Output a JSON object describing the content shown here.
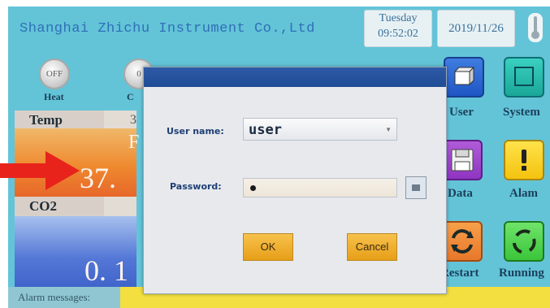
{
  "header": {
    "company": "Shanghai Zhichu Instrument Co.,Ltd",
    "weekday": "Tuesday",
    "time": "09:52:02",
    "date": "2019/11/26"
  },
  "toggles": [
    {
      "state": "OFF",
      "label": "Heat"
    },
    {
      "state": "0",
      "label": "C"
    }
  ],
  "panels": {
    "temp_label": "Temp",
    "temp_partial": "3",
    "temp_mode_partial": "F",
    "temp_value_partial": "37.",
    "co2_label": "CO2",
    "co2_value_partial": "0. 1"
  },
  "side_buttons": [
    {
      "label": "User",
      "icon": "user-icon"
    },
    {
      "label": "System",
      "icon": "system-icon"
    },
    {
      "label": "Data",
      "icon": "data-icon"
    },
    {
      "label": "Alam",
      "icon": "alarm-icon"
    },
    {
      "label": "Restart",
      "icon": "restart-icon"
    },
    {
      "label": "Running",
      "icon": "running-icon"
    }
  ],
  "alarm": {
    "label": "Alarm messages:"
  },
  "login_dialog": {
    "username_label": "User name:",
    "username_value": "user",
    "password_label": "Password:",
    "ok_label": "OK",
    "cancel_label": "Cancel"
  },
  "colors": {
    "screen_bg": "#63c4d8",
    "dialog_title_bar": "#2e5aa6",
    "button": "#f0b030",
    "alarm_bar": "#f3df3f",
    "arrow": "#e8231c"
  }
}
